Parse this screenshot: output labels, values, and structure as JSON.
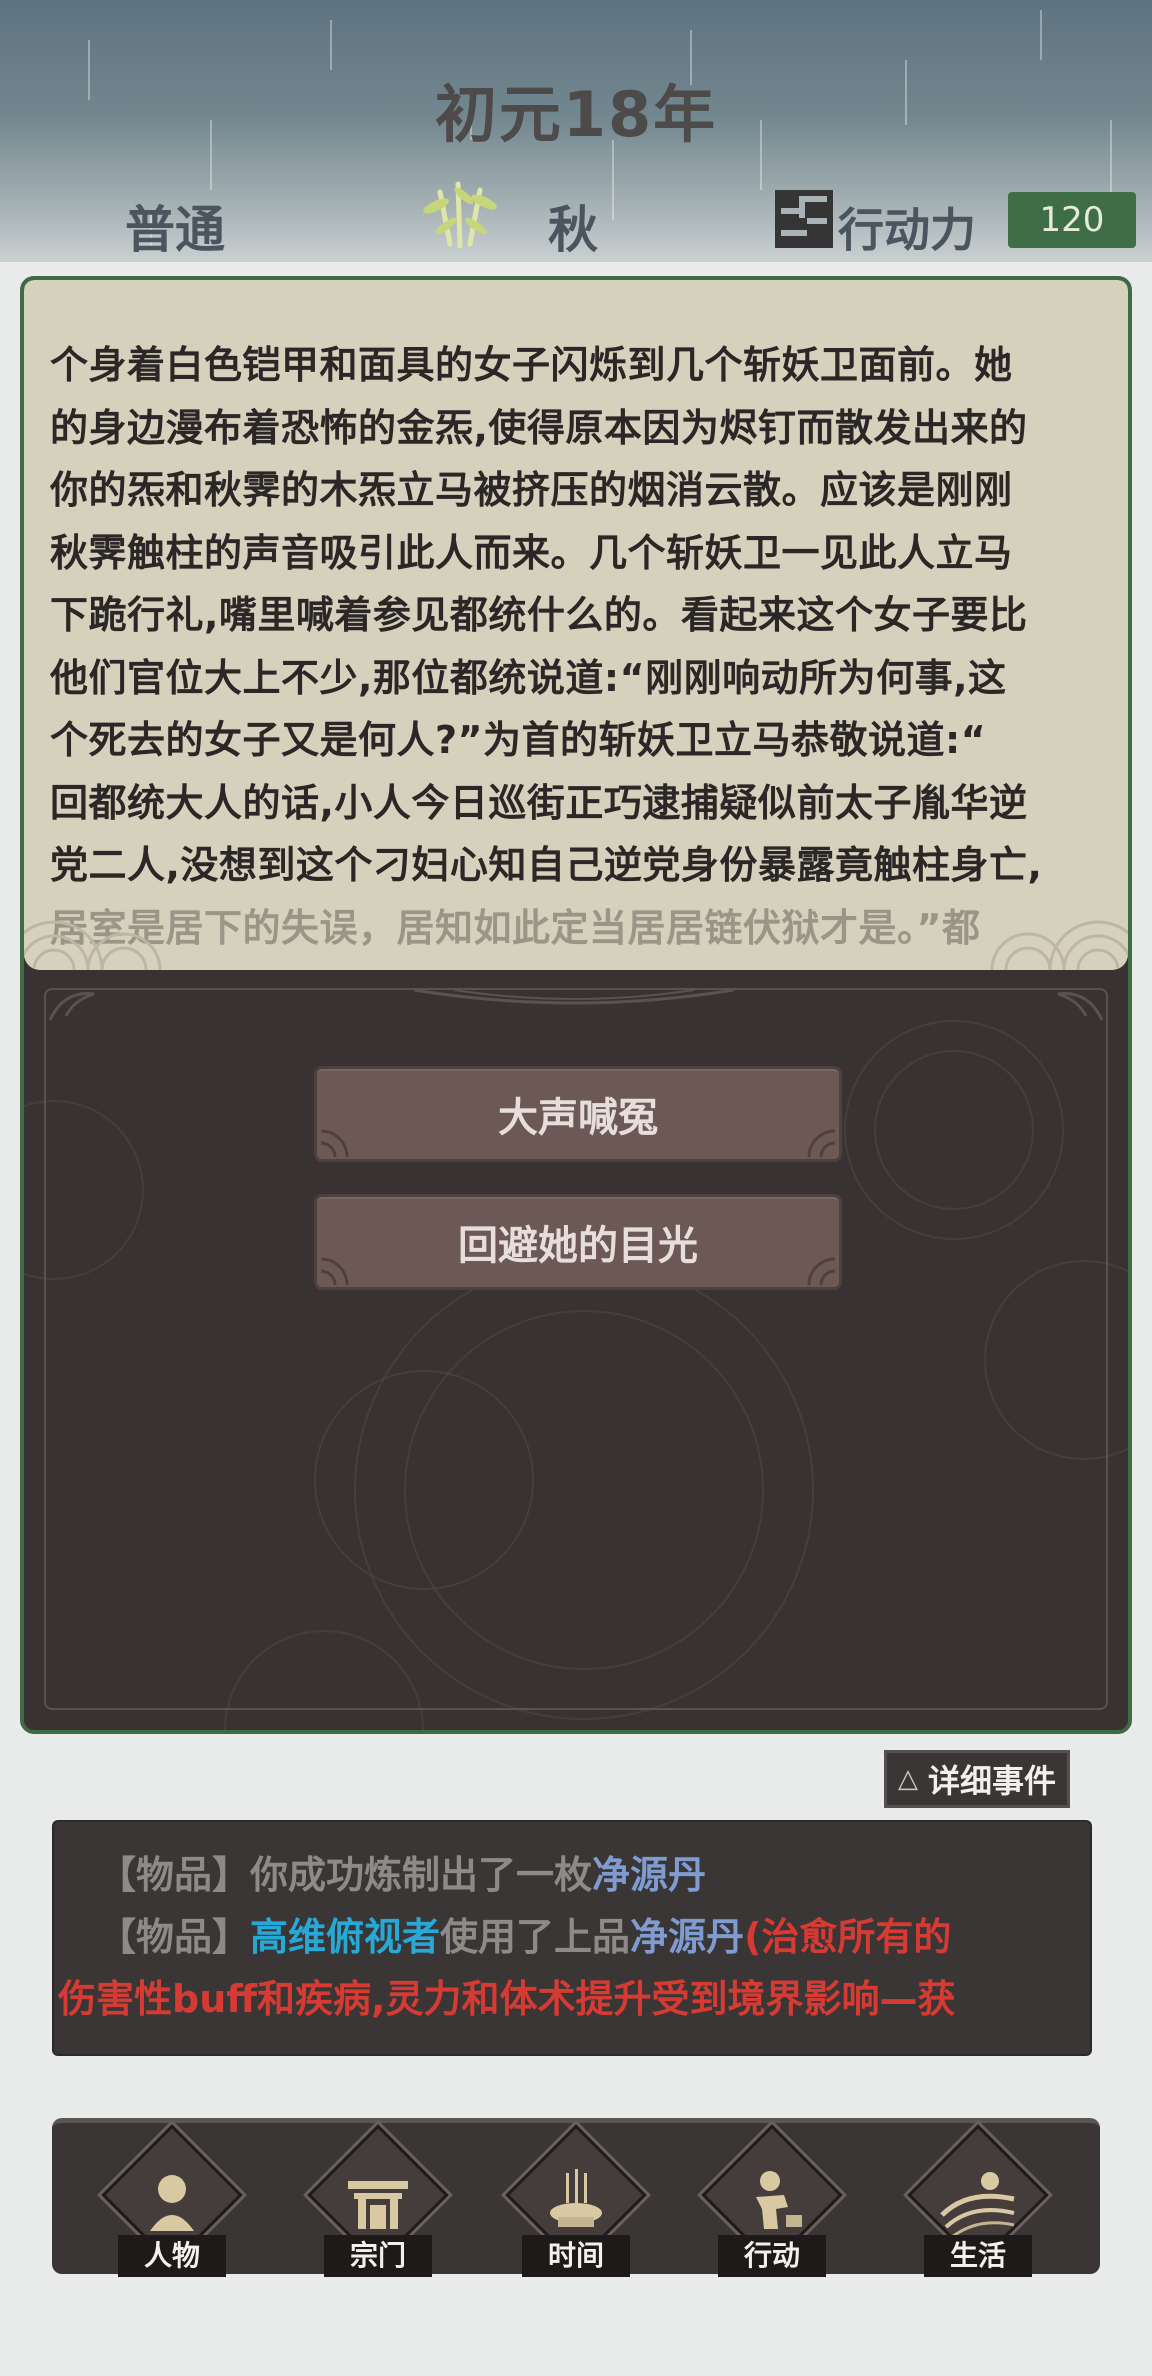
{
  "header": {
    "year": "初元18年",
    "mode": "普通",
    "season": "秋",
    "action_points_label": "行动力",
    "action_points_value": "120",
    "season_icon": "bamboo-icon",
    "action_icon": "grid-glyph-icon"
  },
  "event": {
    "story_lines": [
      "个身着白色铠甲和面具的女子闪烁到几个斩妖卫面前。她",
      "的身边漫布着恐怖的金炁,使得原本因为烬钉而散发出来的",
      "你的炁和秋霁的木炁立马被挤压的烟消云散。应该是刚刚",
      "秋霁触柱的声音吸引此人而来。几个斩妖卫一见此人立马",
      "下跪行礼,嘴里喊着参见都统什么的。看起来这个女子要比",
      "他们官位大上不少,那位都统说道:“刚刚响动所为何事,这",
      "个死去的女子又是何人?”为首的斩妖卫立马恭敬说道:“",
      "回都统大人的话,小人今日巡街正巧逮捕疑似前太子胤华逆",
      "党二人,没想到这个刁妇心知自己逆党身份暴露竟触柱身亡,",
      "居室是居下的失误，居知如此定当居居链伏狱才是。”都"
    ],
    "choices": [
      "大声喊冤",
      "回避她的目光"
    ]
  },
  "detail_button": {
    "icon": "triangle-icon",
    "label": "详细事件"
  },
  "log": {
    "line1": {
      "tag": "【物品】",
      "text": "你成功炼制出了一枚",
      "item": "净源丹"
    },
    "line2": {
      "tag": "【物品】",
      "actor": "高维俯视者",
      "text": "使用了上品",
      "item": "净源丹",
      "effect": "(治愈所有的"
    },
    "line3": {
      "effect": "伤害性buff和疾病,灵力和体术提升受到境界影响—获"
    }
  },
  "nav": {
    "items": [
      {
        "label": "人物",
        "icon": "person-icon"
      },
      {
        "label": "宗门",
        "icon": "gate-icon"
      },
      {
        "label": "时间",
        "icon": "incense-icon"
      },
      {
        "label": "行动",
        "icon": "action-icon"
      },
      {
        "label": "生活",
        "icon": "landscape-icon"
      }
    ]
  },
  "colors": {
    "accent_green": "#3f6d46",
    "panel_dark": "#383332",
    "parchment": "#d6d1bd",
    "choice_button": "#6c5956",
    "log_blue": "#7f9bd0",
    "log_cyan": "#27a8d6",
    "log_red": "#d53b33"
  }
}
